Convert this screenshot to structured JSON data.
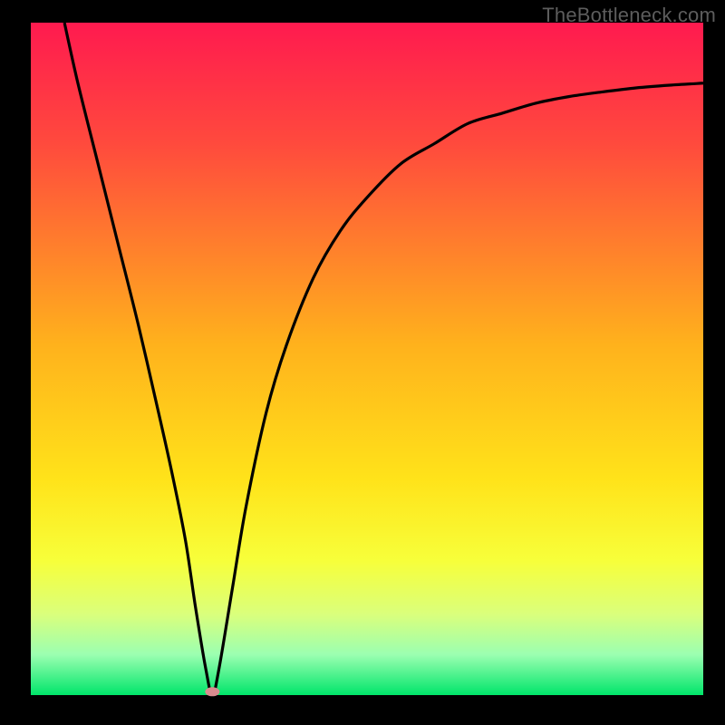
{
  "watermark": "TheBottleneck.com",
  "colors": {
    "frame": "#000000",
    "curve": "#000000",
    "marker": "#d98b8f",
    "gradient_stops": [
      {
        "pos": 0,
        "color": "#ff1a4f"
      },
      {
        "pos": 18,
        "color": "#ff4a3d"
      },
      {
        "pos": 48,
        "color": "#ffb21c"
      },
      {
        "pos": 68,
        "color": "#ffe31a"
      },
      {
        "pos": 80,
        "color": "#f7ff3a"
      },
      {
        "pos": 88,
        "color": "#daff7c"
      },
      {
        "pos": 94,
        "color": "#9bffb1"
      },
      {
        "pos": 100,
        "color": "#00e56a"
      }
    ]
  },
  "chart_data": {
    "type": "line",
    "title": "",
    "xlabel": "",
    "ylabel": "",
    "xlim": [
      0,
      100
    ],
    "ylim": [
      0,
      100
    ],
    "grid": false,
    "legend": false,
    "series": [
      {
        "name": "bottleneck-curve",
        "x": [
          5,
          7,
          10,
          13,
          16,
          19,
          21,
          23,
          24.5,
          26,
          27,
          28,
          30,
          32,
          35,
          38,
          42,
          46,
          50,
          55,
          60,
          65,
          70,
          75,
          80,
          85,
          90,
          95,
          100
        ],
        "y": [
          100,
          91,
          79,
          67,
          55,
          42,
          33,
          23,
          13,
          4,
          0,
          4,
          16,
          28,
          42,
          52,
          62,
          69,
          74,
          79,
          82,
          85,
          86.5,
          88,
          89,
          89.7,
          90.3,
          90.7,
          91
        ]
      }
    ],
    "marker": {
      "x": 27,
      "y": 0.5,
      "label": "optimal-point"
    }
  }
}
